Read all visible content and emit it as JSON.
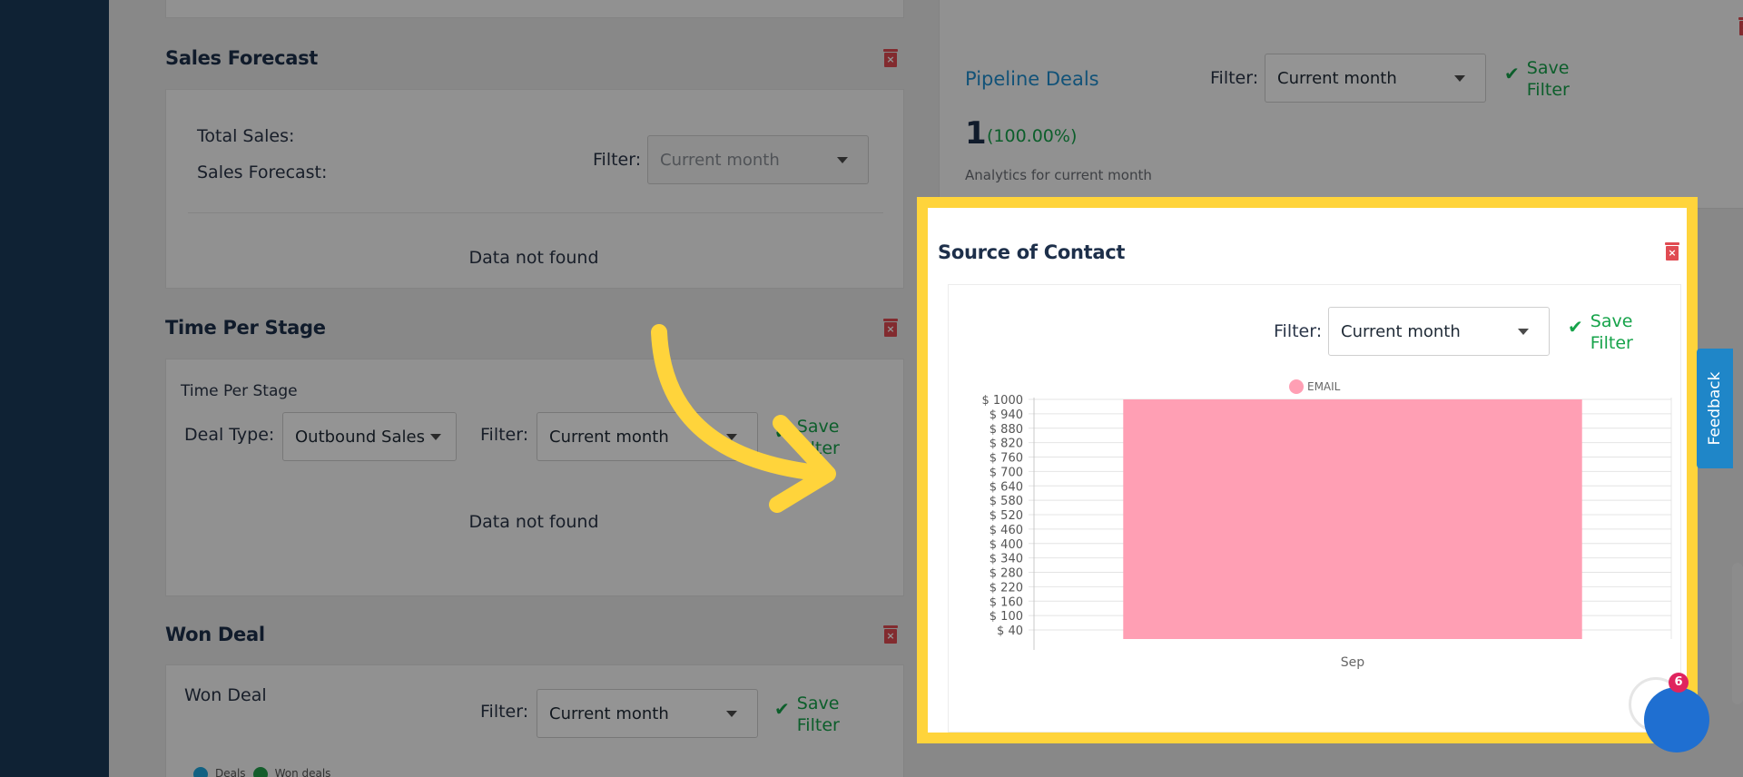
{
  "sales_forecast": {
    "title": "Sales Forecast",
    "total_sales_label": "Total Sales:",
    "sales_forecast_label": "Sales Forecast:",
    "filter_label": "Filter:",
    "filter_value": "Current month",
    "empty_text": "Data not found"
  },
  "time_per_stage": {
    "title": "Time Per Stage",
    "subtitle": "Time Per Stage",
    "deal_type_label": "Deal Type:",
    "deal_type_value": "Outbound Sales",
    "filter_label": "Filter:",
    "filter_value": "Current month",
    "save_filter": "Save\nFilter",
    "empty_text": "Data not found"
  },
  "won_deal": {
    "title": "Won Deal",
    "subtitle": "Won Deal",
    "filter_label": "Filter:",
    "filter_value": "Current month",
    "save_filter": "Save\nFilter",
    "legend": [
      "Deals",
      "Won deals"
    ]
  },
  "pipeline_deals": {
    "title": "Pipeline Deals",
    "filter_label": "Filter:",
    "filter_value": "Current month",
    "save_filter": "Save\nFilter",
    "count": "1",
    "percent": "(100.00%)",
    "caption": "Analytics for current month"
  },
  "source_of_contact": {
    "title": "Source of Contact",
    "filter_label": "Filter:",
    "filter_value": "Current month",
    "save_filter": "Save\nFilter"
  },
  "feedback_tab": "Feedback",
  "chat_badge": "6",
  "colors": {
    "accent_green": "#16a34a",
    "delete_red": "#e04b52",
    "pipeline_blue": "#1f8ecf",
    "highlight_yellow": "#ffd43b",
    "bar_pink": "#ff9fb4"
  },
  "chart_data": {
    "type": "bar",
    "categories": [
      "Sep"
    ],
    "series": [
      {
        "name": "EMAIL",
        "values": [
          1000
        ]
      }
    ],
    "y_ticks": [
      "$ 1000",
      "$ 940",
      "$ 880",
      "$ 820",
      "$ 760",
      "$ 700",
      "$ 640",
      "$ 580",
      "$ 520",
      "$ 460",
      "$ 400",
      "$ 340",
      "$ 280",
      "$ 220",
      "$ 160",
      "$ 100",
      "$ 40"
    ],
    "ylim": [
      0,
      1000
    ],
    "legend_position": "top",
    "grid": true
  }
}
